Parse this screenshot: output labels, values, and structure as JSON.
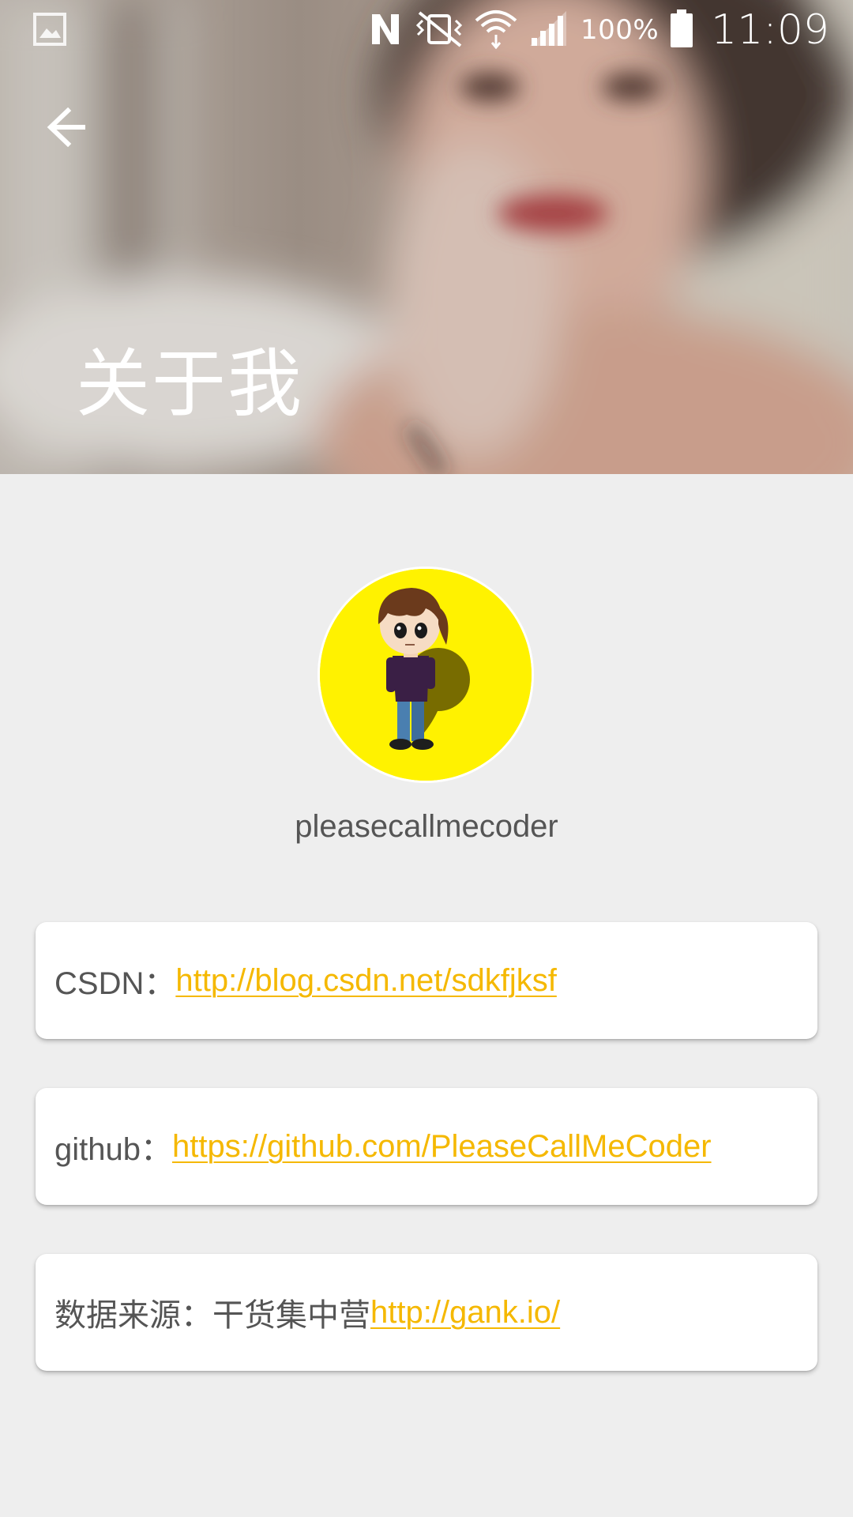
{
  "status_bar": {
    "battery_percent": "100%",
    "time": "11:09",
    "icons": [
      "gallery-icon",
      "nfc-icon",
      "vibrate-off-icon",
      "wifi-icon",
      "signal-icon",
      "battery-icon"
    ]
  },
  "header": {
    "title": "关于我",
    "back_icon": "arrow-left-icon"
  },
  "profile": {
    "username": "pleasecallmecoder",
    "avatar_bg": "#fff200"
  },
  "links": [
    {
      "label": "CSDN：",
      "url": "http://blog.csdn.net/sdkfjksf"
    },
    {
      "label": "github：",
      "url": "https://github.com/PleaseCallMeCoder"
    },
    {
      "label": "数据来源：干货集中营",
      "url": "http://gank.io/"
    }
  ],
  "colors": {
    "background": "#eeeeee",
    "link": "#f5b800",
    "label": "#555555",
    "card": "#ffffff"
  }
}
